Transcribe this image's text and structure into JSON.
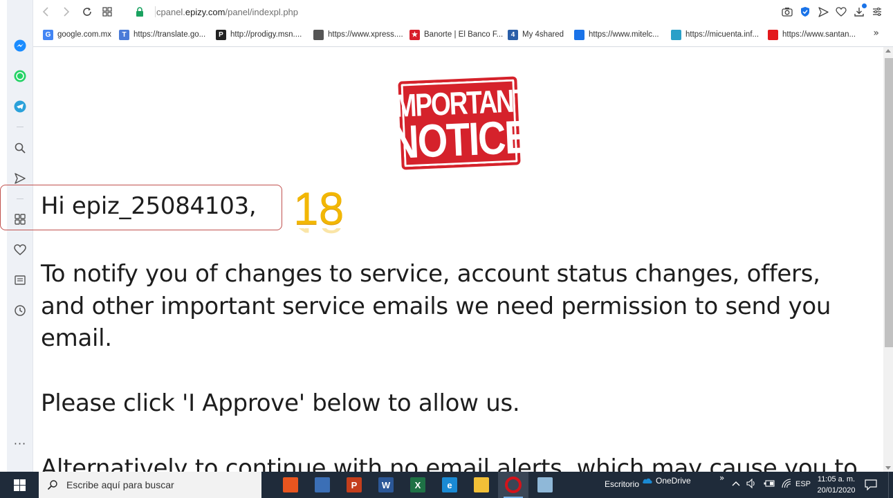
{
  "browser": {
    "url_prefix": "cpanel.",
    "url_domain": "epizy.com",
    "url_path": "/panel/indexpl.php"
  },
  "bookmarks": [
    {
      "label": "google.com.mx",
      "icon": "google-icon",
      "color": "#4285f4"
    },
    {
      "label": "https://translate.go...",
      "icon": "translate-icon",
      "color": "#4a7bd8"
    },
    {
      "label": "http://prodigy.msn....",
      "icon": "prodigy-icon",
      "color": "#222222"
    },
    {
      "label": "https://www.xpress....",
      "icon": "file-icon",
      "color": "#555555"
    },
    {
      "label": "Banorte | El Banco F...",
      "icon": "banorte-icon",
      "color": "#d81e2b"
    },
    {
      "label": "My 4shared",
      "icon": "4shared-icon",
      "color": "#2a5ea8"
    },
    {
      "label": "https://www.mitelc...",
      "icon": "mitelcel-icon",
      "color": "#1a73e8"
    },
    {
      "label": "https://micuenta.inf...",
      "icon": "micuenta-icon",
      "color": "#2aa0c8"
    },
    {
      "label": "https://www.santan...",
      "icon": "santander-icon",
      "color": "#e3191c"
    }
  ],
  "bookmarks_more": "»",
  "notice": {
    "line1": "IMPORTANT",
    "line2": "NOTICE"
  },
  "message": {
    "greeting": "Hi epiz_25084103,",
    "p1_line1": "To notify you of changes to service, account status changes, offers,",
    "p1_line2": "and other important service emails we need permission to send you",
    "p1_line3": "email.",
    "p2": "Please click 'I Approve' below to allow us.",
    "p3_partial": "Alternatively to continue with no email alerts, which may cause you to"
  },
  "annotation": {
    "step_number": "18",
    "highlight_color": "#c0504d",
    "number_color": "#f2b705"
  },
  "sidebar": {
    "more_label": "···"
  },
  "taskbar": {
    "search_placeholder": "Escribe aquí para buscar",
    "desktop_label": "Escritorio",
    "onedrive_label": "OneDrive",
    "chevron": "»",
    "language": "ESP",
    "time": "11:05 a. m.",
    "date": "20/01/2020",
    "apps": [
      {
        "name": "office-icon",
        "letter": "",
        "color": "#e8551f"
      },
      {
        "name": "firefox-like-icon",
        "letter": "",
        "color": "#3b6fb6"
      },
      {
        "name": "powerpoint-icon",
        "letter": "P",
        "color": "#c43e1c"
      },
      {
        "name": "word-icon",
        "letter": "W",
        "color": "#2b5797"
      },
      {
        "name": "excel-icon",
        "letter": "X",
        "color": "#1e7145"
      },
      {
        "name": "edge-icon",
        "letter": "e",
        "color": "#1a8ad4"
      },
      {
        "name": "file-explorer-icon",
        "letter": "",
        "color": "#f2c037"
      },
      {
        "name": "opera-icon",
        "letter": "O",
        "color": "#d3131b"
      },
      {
        "name": "notes-icon",
        "letter": "",
        "color": "#8fb8d8"
      }
    ]
  }
}
